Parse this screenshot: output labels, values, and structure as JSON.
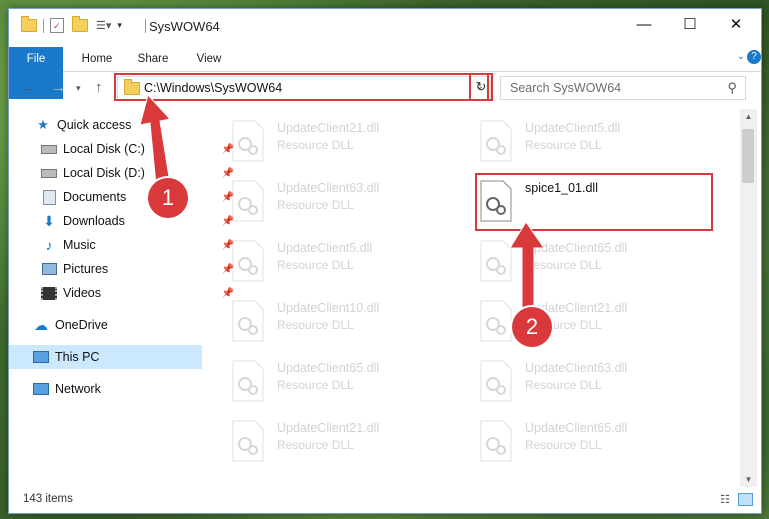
{
  "window": {
    "title": "SysWOW64"
  },
  "ribbon": {
    "tabs": [
      "File",
      "Home",
      "Share",
      "View"
    ]
  },
  "address": {
    "path": "C:\\Windows\\SysWOW64"
  },
  "search": {
    "placeholder": "Search SysWOW64"
  },
  "sidebar": {
    "items": [
      {
        "label": "Quick access",
        "icon": "star-icon",
        "pinned": false
      },
      {
        "label": "Local Disk (C:)",
        "icon": "drive-icon",
        "pinned": true
      },
      {
        "label": "Local Disk (D:)",
        "icon": "drive-icon",
        "pinned": true
      },
      {
        "label": "Documents",
        "icon": "documents-icon",
        "pinned": true
      },
      {
        "label": "Downloads",
        "icon": "download-icon",
        "pinned": true
      },
      {
        "label": "Music",
        "icon": "music-icon",
        "pinned": true
      },
      {
        "label": "Pictures",
        "icon": "pictures-icon",
        "pinned": true
      },
      {
        "label": "Videos",
        "icon": "videos-icon",
        "pinned": true
      },
      {
        "label": "OneDrive",
        "icon": "onedrive-icon",
        "pinned": false
      },
      {
        "label": "This PC",
        "icon": "computer-icon",
        "pinned": false
      },
      {
        "label": "Network",
        "icon": "network-icon",
        "pinned": false
      }
    ]
  },
  "files": [
    {
      "name": "UpdateClient21.dll",
      "type": "Resource DLL"
    },
    {
      "name": "UpdateClient5.dll",
      "type": "Resource DLL"
    },
    {
      "name": "UpdateClient63.dll",
      "type": "Resource DLL"
    },
    {
      "name": "spice1_01.dll",
      "type": ""
    },
    {
      "name": "UpdateClient5.dll",
      "type": "Resource DLL"
    },
    {
      "name": "UpdateClient65.dll",
      "type": "Resource DLL"
    },
    {
      "name": "UpdateClient10.dll",
      "type": "Resource DLL"
    },
    {
      "name": "UpdateClient21.dll",
      "type": "Resource DLL"
    },
    {
      "name": "UpdateClient65.dll",
      "type": "Resource DLL"
    },
    {
      "name": "UpdateClient63.dll",
      "type": "Resource DLL"
    },
    {
      "name": "UpdateClient21.dll",
      "type": "Resource DLL"
    },
    {
      "name": "UpdateClient65.dll",
      "type": "Resource DLL"
    }
  ],
  "status": {
    "item_count": "143 items"
  },
  "callouts": {
    "first": "1",
    "second": "2"
  },
  "colors": {
    "accent": "#1979ca",
    "callout": "#d9393a",
    "selection": "#cce8ff"
  }
}
